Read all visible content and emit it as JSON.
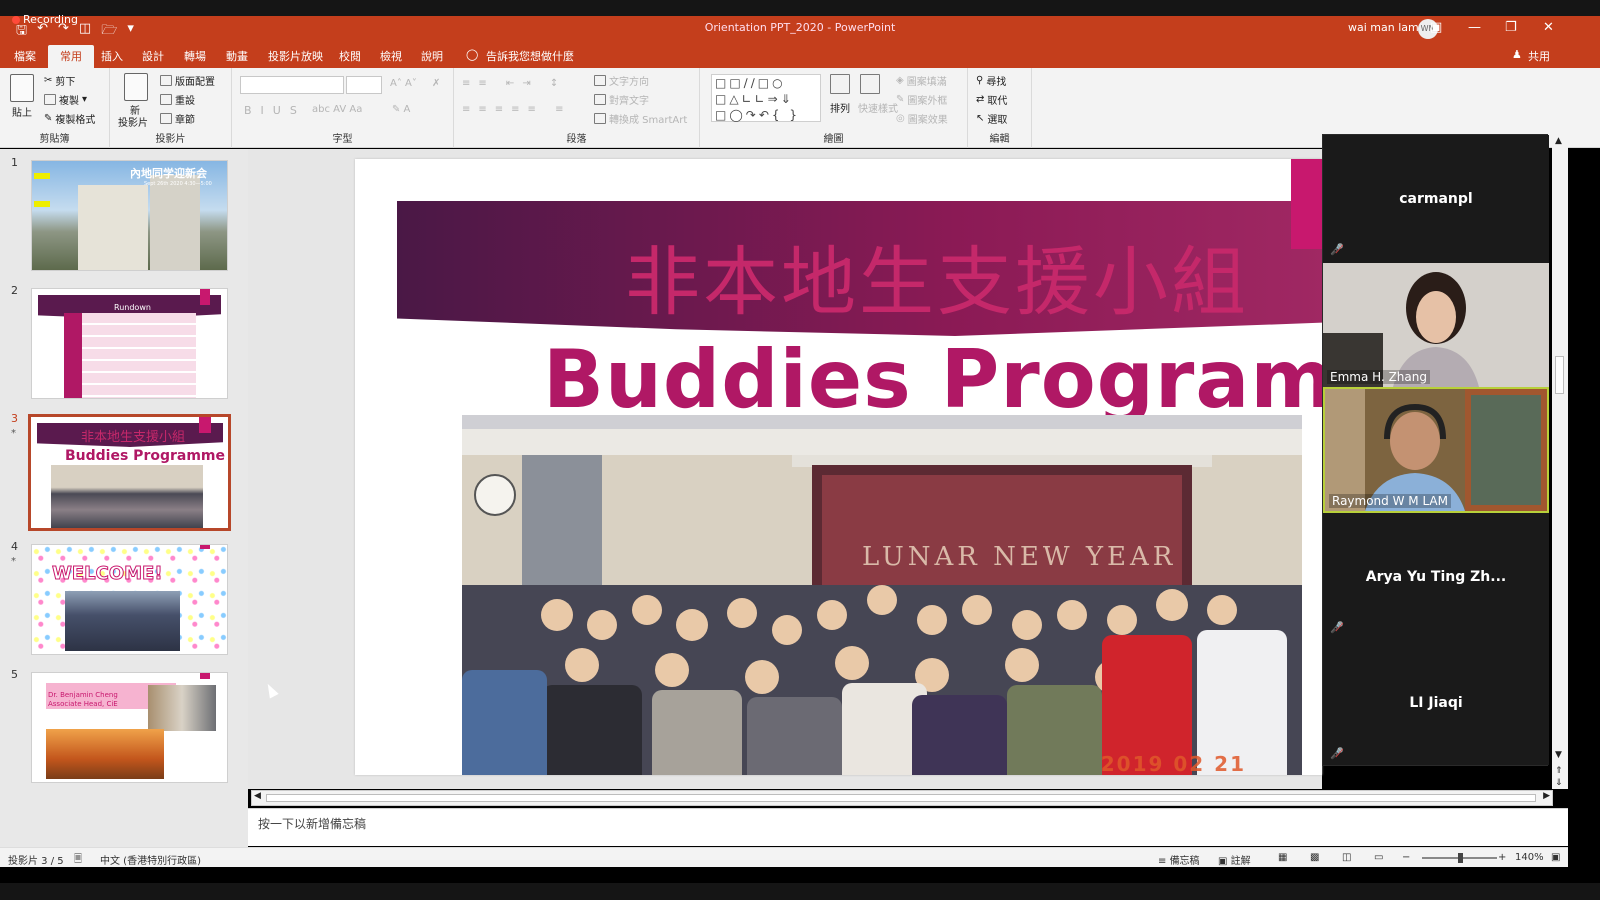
{
  "titlebar": {
    "recording": "Recording",
    "doc_title": "Orientation PPT_2020  -  PowerPoint",
    "user_name": "wai man lam",
    "user_initials": "WM"
  },
  "menu": {
    "tabs": [
      "檔案",
      "常用",
      "插入",
      "設計",
      "轉場",
      "動畫",
      "投影片放映",
      "校閱",
      "檢視",
      "說明"
    ],
    "tell_me": "告訴我您想做什麼",
    "share": "共用"
  },
  "ribbon": {
    "clipboard": {
      "label": "剪貼簿",
      "paste": "貼上",
      "cut": "剪下",
      "copy": "複製",
      "format_painter": "複製格式"
    },
    "slides": {
      "label": "投影片",
      "new_slide": "新",
      "new_slide2": "投影片",
      "layout": "版面配置",
      "reset": "重設",
      "section": "章節"
    },
    "font": {
      "label": "字型"
    },
    "paragraph": {
      "label": "段落",
      "text_direction": "文字方向",
      "align_text": "對齊文字",
      "smartart": "轉換成 SmartArt"
    },
    "drawing": {
      "label": "繪圖",
      "arrange": "排列",
      "quick_styles": "快速樣式",
      "fill": "圖案填滿",
      "outline": "圖案外框",
      "effects": "圖案效果"
    },
    "editing": {
      "label": "編輯",
      "find": "尋找",
      "replace": "取代",
      "select": "選取"
    }
  },
  "thumbs": {
    "s1": {
      "num": "1",
      "title": "內地同学迎新会",
      "sub": "Sept 26th 2020 4:30—5:00"
    },
    "s2": {
      "num": "2",
      "title": "Rundown"
    },
    "s3": {
      "num": "3",
      "cn": "非本地生支援小組",
      "en": "Buddies Programme"
    },
    "s4": {
      "num": "4",
      "title": "WELCOME!"
    },
    "s5": {
      "num": "5",
      "line1": "Dr. Benjamin Cheng",
      "line2": "Associate Head, CiE"
    }
  },
  "slide": {
    "cn_title": "非本地生支援小組",
    "en_title": "Buddies Programme",
    "photo_date": "2019 02 21",
    "banner_text": "LUNAR NEW YEAR"
  },
  "notes": {
    "placeholder": "按一下以新增備忘稿"
  },
  "status": {
    "slide_of": "投影片 3 / 5",
    "language": "中文 (香港特別行政區)",
    "notes_btn": "備忘稿",
    "comments_btn": "註解",
    "zoom": "140%"
  },
  "participants": [
    {
      "name": "carmanpl",
      "type": "name",
      "muted": true
    },
    {
      "name": "Emma H. Zhang",
      "type": "video"
    },
    {
      "name": "Raymond W M LAM",
      "type": "video",
      "speaking": true
    },
    {
      "name": "Arya Yu Ting Zh...",
      "type": "name",
      "muted": true
    },
    {
      "name": "LI Jiaqi",
      "type": "name",
      "muted": true
    }
  ],
  "colors": {
    "accent": "#c43e1c",
    "slide_magenta": "#b01865",
    "banner_purple": "#5a1a4e",
    "speaker_border": "#b8d03a"
  }
}
